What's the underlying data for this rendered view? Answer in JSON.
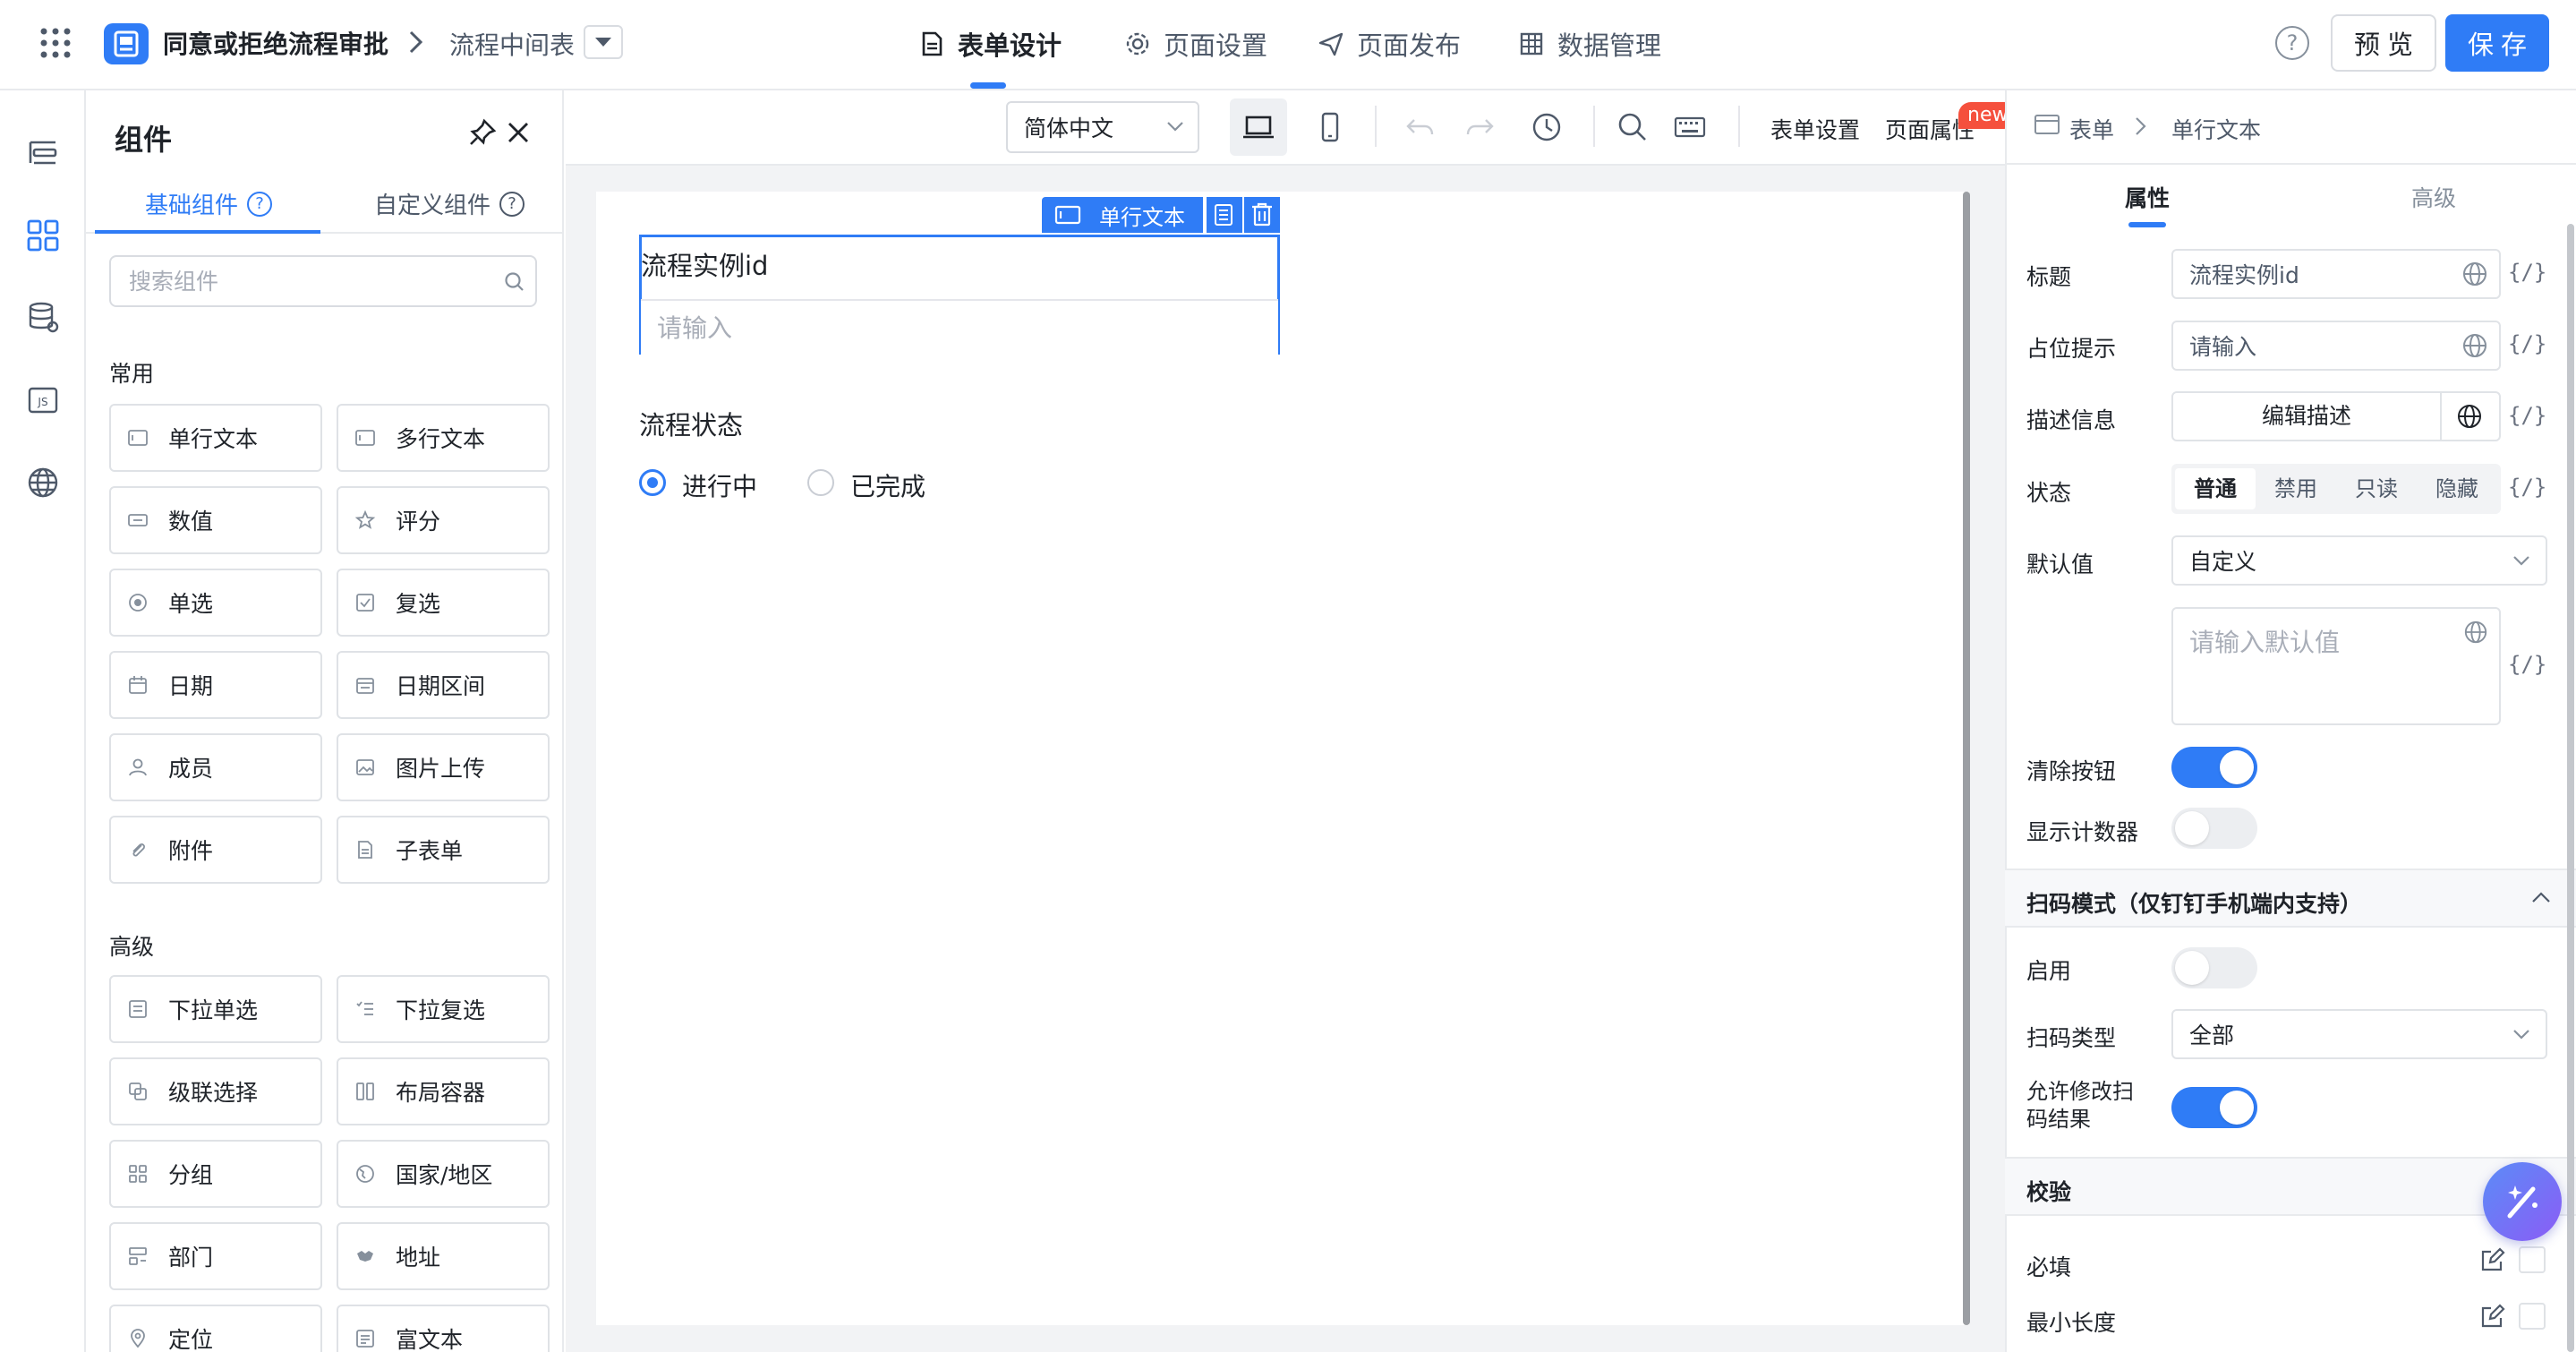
{
  "header": {
    "app_title": "同意或拒绝流程审批",
    "breadcrumb": "流程中间表",
    "nav": [
      {
        "label": "表单设计",
        "icon": "document-icon",
        "active": true
      },
      {
        "label": "页面设置",
        "icon": "gear-icon",
        "active": false
      },
      {
        "label": "页面发布",
        "icon": "send-icon",
        "active": false
      },
      {
        "label": "数据管理",
        "icon": "table-icon",
        "active": false
      }
    ],
    "help": "?",
    "preview_label": "预 览",
    "save_label": "保 存",
    "accent": "#2f7cf6"
  },
  "components": {
    "title": "组件",
    "tabs": [
      "基础组件",
      "自定义组件"
    ],
    "search_placeholder": "搜索组件",
    "sections": [
      {
        "title": "常用",
        "items": [
          {
            "label": "单行文本",
            "icon": "single-line-text-icon"
          },
          {
            "label": "多行文本",
            "icon": "multi-line-text-icon"
          },
          {
            "label": "数值",
            "icon": "number-icon"
          },
          {
            "label": "评分",
            "icon": "star-icon"
          },
          {
            "label": "单选",
            "icon": "radio-icon"
          },
          {
            "label": "复选",
            "icon": "checkbox-icon"
          },
          {
            "label": "日期",
            "icon": "calendar-icon"
          },
          {
            "label": "日期区间",
            "icon": "date-range-icon"
          },
          {
            "label": "成员",
            "icon": "user-icon"
          },
          {
            "label": "图片上传",
            "icon": "image-icon"
          },
          {
            "label": "附件",
            "icon": "paperclip-icon"
          },
          {
            "label": "子表单",
            "icon": "subform-icon"
          }
        ]
      },
      {
        "title": "高级",
        "items": [
          {
            "label": "下拉单选",
            "icon": "dropdown-icon"
          },
          {
            "label": "下拉复选",
            "icon": "checklist-icon"
          },
          {
            "label": "级联选择",
            "icon": "cascade-icon"
          },
          {
            "label": "布局容器",
            "icon": "layout-icon"
          },
          {
            "label": "分组",
            "icon": "group-icon"
          },
          {
            "label": "国家/地区",
            "icon": "globe-icon"
          },
          {
            "label": "部门",
            "icon": "department-icon"
          },
          {
            "label": "地址",
            "icon": "map-icon"
          },
          {
            "label": "定位",
            "icon": "location-icon"
          },
          {
            "label": "富文本",
            "icon": "rich-text-icon"
          }
        ]
      }
    ]
  },
  "toolbar": {
    "language": "简体中文",
    "form_settings": "表单设置",
    "page_props": "页面属性",
    "new_badge": "new"
  },
  "canvas": {
    "selected_tag": "单行文本",
    "field1_label": "流程实例id",
    "field1_placeholder": "请输入",
    "field2_label": "流程状态",
    "radio_options": [
      "进行中",
      "已完成"
    ],
    "radio_selected": 0
  },
  "props": {
    "breadcrumb": [
      "表单",
      "单行文本"
    ],
    "tabs": [
      "属性",
      "高级"
    ],
    "braces": "{/}",
    "title_label": "标题",
    "title_value": "流程实例id",
    "placeholder_label": "占位提示",
    "placeholder_value": "请输入",
    "desc_label": "描述信息",
    "desc_button": "编辑描述",
    "state_label": "状态",
    "state_options": [
      "普通",
      "禁用",
      "只读",
      "隐藏"
    ],
    "state_selected": 0,
    "default_label": "默认值",
    "default_mode": "自定义",
    "default_placeholder": "请输入默认值",
    "clear_label": "清除按钮",
    "clear_on": true,
    "counter_label": "显示计数器",
    "counter_on": false,
    "scan_section": "扫码模式（仅钉钉手机端内支持）",
    "scan_enable_label": "启用",
    "scan_enable_on": false,
    "scan_type_label": "扫码类型",
    "scan_type_value": "全部",
    "scan_modify_label": "允许修改扫码结果",
    "scan_modify_on": true,
    "validation_section": "校验",
    "required_label": "必填",
    "minlen_label": "最小长度"
  }
}
